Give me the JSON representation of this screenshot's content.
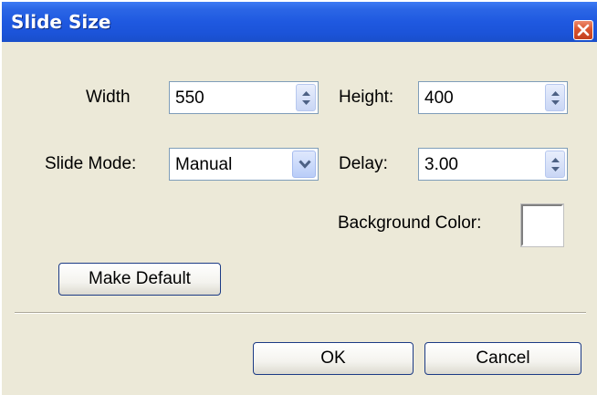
{
  "window": {
    "title": "Slide Size"
  },
  "fields": {
    "width": {
      "label": "Width",
      "value": "550"
    },
    "height": {
      "label": "Height:",
      "value": "400"
    },
    "slide_mode": {
      "label": "Slide Mode:",
      "value": "Manual"
    },
    "delay": {
      "label": "Delay:",
      "value": "3.00"
    },
    "background_color": {
      "label": "Background Color:",
      "color": "#ffffff"
    }
  },
  "buttons": {
    "make_default": "Make Default",
    "ok": "OK",
    "cancel": "Cancel"
  },
  "icons": {
    "close": "close-icon",
    "spinner": "spinner-arrows-icon",
    "dropdown": "chevron-down-icon"
  },
  "colors": {
    "titlebar": "#1f59e0",
    "dialog_bg": "#ece9d8",
    "close_button": "#d9542f"
  }
}
